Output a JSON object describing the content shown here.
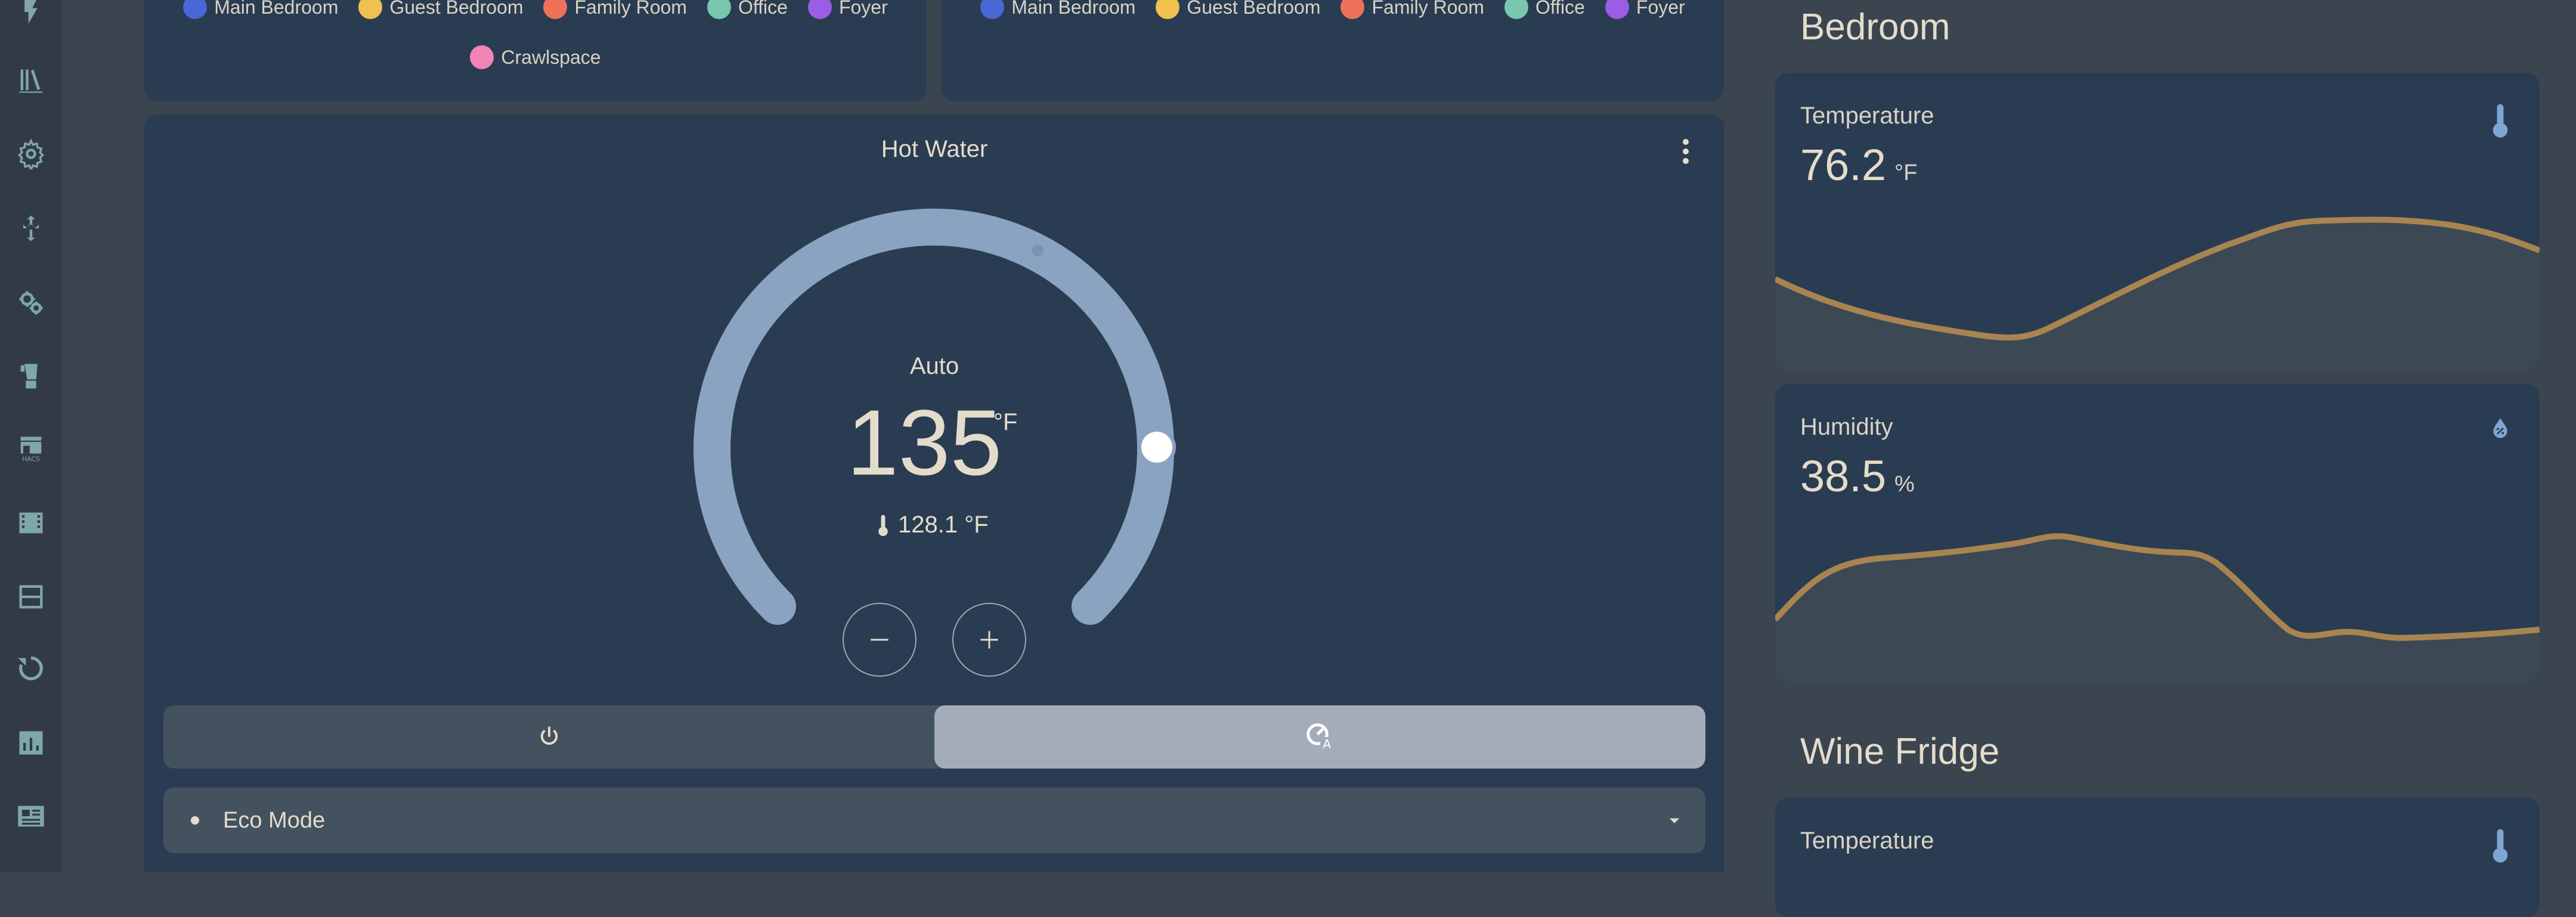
{
  "legend_left": [
    {
      "label": "Main Bedroom",
      "color": "#4a67d6"
    },
    {
      "label": "Guest Bedroom",
      "color": "#f1c04f"
    },
    {
      "label": "Family Room",
      "color": "#ee7159"
    },
    {
      "label": "Office",
      "color": "#77c7ad"
    },
    {
      "label": "Foyer",
      "color": "#9c5ce4"
    },
    {
      "label": "Crawlspace",
      "color": "#f184b4"
    }
  ],
  "legend_right": [
    {
      "label": "Main Bedroom",
      "color": "#4a67d6"
    },
    {
      "label": "Guest Bedroom",
      "color": "#f1c04f"
    },
    {
      "label": "Family Room",
      "color": "#ee7159"
    },
    {
      "label": "Office",
      "color": "#77c7ad"
    },
    {
      "label": "Foyer",
      "color": "#9c5ce4"
    }
  ],
  "thermostat": {
    "title": "Hot Water",
    "mode": "Auto",
    "target": "135",
    "target_unit": "°F",
    "current": "128.1 °F",
    "preset": "Eco Mode"
  },
  "bedroom": {
    "title": "Bedroom",
    "temperature": {
      "label": "Temperature",
      "value": "76.2",
      "unit": "°F"
    },
    "humidity": {
      "label": "Humidity",
      "value": "38.5",
      "unit": "%"
    }
  },
  "wine_fridge": {
    "title": "Wine Fridge",
    "temperature": {
      "label": "Temperature"
    }
  },
  "colors": {
    "accent_line": "#a88451",
    "dial": "#8aa3c1",
    "icon": "#9fb9d8"
  },
  "sidebar_icons": [
    "lightning-icon",
    "library-icon",
    "settings-icon",
    "network-icon",
    "cog-cluster-icon",
    "blender-icon",
    "hacs-icon",
    "film-icon",
    "layout-icon",
    "restore-icon",
    "chart-icon",
    "newspaper-icon"
  ]
}
